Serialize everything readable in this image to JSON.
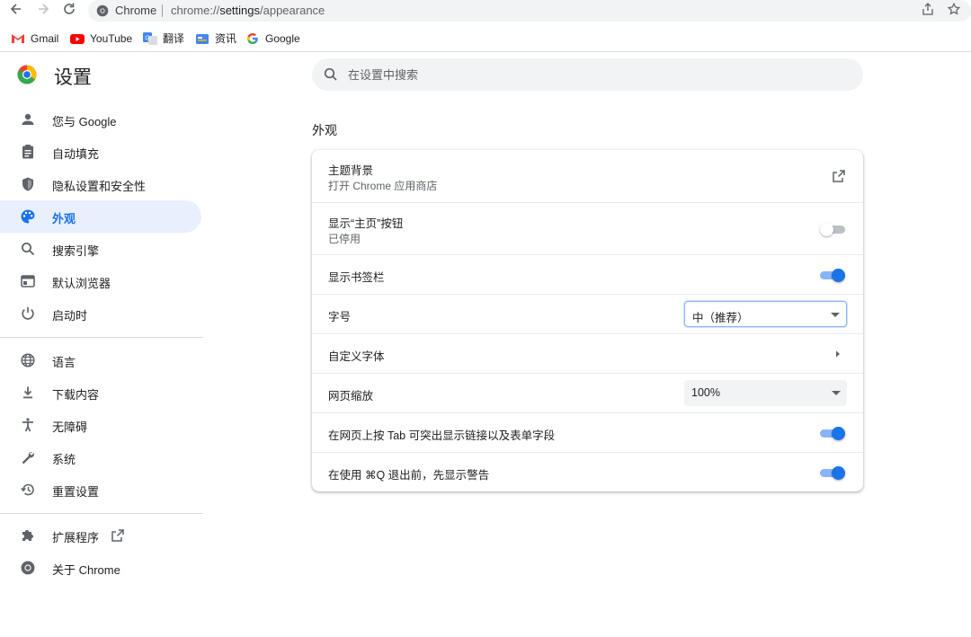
{
  "browser": {
    "site_label": "Chrome",
    "url_host": "chrome://",
    "url_bold": "settings",
    "url_path": "/appearance"
  },
  "bookmarks": [
    {
      "label": "Gmail",
      "icon": "gmail-icon"
    },
    {
      "label": "YouTube",
      "icon": "youtube-icon"
    },
    {
      "label": "翻译",
      "icon": "translate-icon"
    },
    {
      "label": "资讯",
      "icon": "news-icon"
    },
    {
      "label": "Google",
      "icon": "google-icon"
    }
  ],
  "header": {
    "title": "设置",
    "search_placeholder": "在设置中搜索"
  },
  "sidebar": {
    "items": [
      {
        "label": "您与 Google",
        "icon": "person-icon"
      },
      {
        "label": "自动填充",
        "icon": "clipboard-icon"
      },
      {
        "label": "隐私设置和安全性",
        "icon": "shield-icon"
      },
      {
        "label": "外观",
        "icon": "palette-icon",
        "active": true
      },
      {
        "label": "搜索引擎",
        "icon": "search-icon"
      },
      {
        "label": "默认浏览器",
        "icon": "browser-icon"
      },
      {
        "label": "启动时",
        "icon": "power-icon"
      },
      {
        "label": "语言",
        "icon": "globe-icon"
      },
      {
        "label": "下载内容",
        "icon": "download-icon"
      },
      {
        "label": "无障碍",
        "icon": "accessibility-icon"
      },
      {
        "label": "系统",
        "icon": "wrench-icon"
      },
      {
        "label": "重置设置",
        "icon": "restore-icon"
      },
      {
        "label": "扩展程序",
        "icon": "puzzle-icon"
      },
      {
        "label": "关于 Chrome",
        "icon": "chrome-icon"
      }
    ]
  },
  "main": {
    "section_title": "外观",
    "theme": {
      "label": "主题背景",
      "sub": "打开 Chrome 应用商店"
    },
    "home_button": {
      "label": "显示“主页”按钮",
      "sub": "已停用",
      "enabled": false
    },
    "bookmarks_bar": {
      "label": "显示书签栏",
      "enabled": true
    },
    "font_size": {
      "label": "字号",
      "value": "中（推荐）"
    },
    "custom_fonts": {
      "label": "自定义字体"
    },
    "page_zoom": {
      "label": "网页缩放",
      "value": "100%"
    },
    "tab_highlight": {
      "label": "在网页上按 Tab 可突出显示链接以及表单字段",
      "enabled": true
    },
    "quit_warning": {
      "label": "在使用 ⌘Q 退出前，先显示警告",
      "enabled": true
    }
  },
  "colors": {
    "accent": "#1a73e8",
    "active_bg": "#e8f0fe"
  }
}
